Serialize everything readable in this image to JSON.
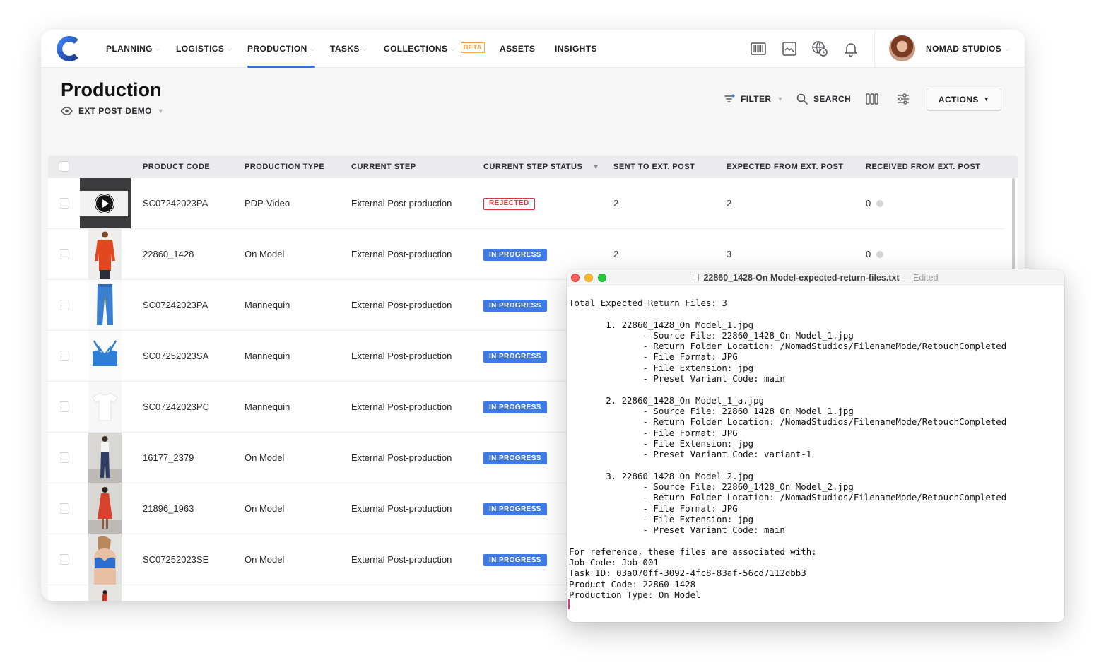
{
  "nav": {
    "items": [
      {
        "label": "PLANNING",
        "dropdown": true
      },
      {
        "label": "LOGISTICS",
        "dropdown": true
      },
      {
        "label": "PRODUCTION",
        "dropdown": true,
        "active": true
      },
      {
        "label": "TASKS",
        "dropdown": true
      },
      {
        "label": "COLLECTIONS",
        "dropdown": true
      },
      {
        "label": "ASSETS",
        "dropdown": false
      },
      {
        "label": "INSIGHTS",
        "dropdown": false
      }
    ],
    "beta_badge": "BETA",
    "org_name": "NOMAD STUDIOS",
    "icons": [
      "barcode-icon",
      "image-icon",
      "globe-clock-icon",
      "bell-icon"
    ]
  },
  "page": {
    "title": "Production",
    "view_name": "EXT POST DEMO"
  },
  "toolbar": {
    "filter_label": "FILTER",
    "search_label": "SEARCH",
    "actions_label": "ACTIONS"
  },
  "table": {
    "columns": [
      "PRODUCT CODE",
      "PRODUCTION TYPE",
      "CURRENT STEP",
      "CURRENT STEP STATUS",
      "SENT TO EXT. POST",
      "EXPECTED FROM EXT. POST",
      "RECEIVED FROM EXT. POST"
    ],
    "rows": [
      {
        "code": "SC07242023PA",
        "type": "PDP-Video",
        "step": "External Post-production",
        "status": "REJECTED",
        "sent": "2",
        "expected": "2",
        "received": "0",
        "thumb": "video"
      },
      {
        "code": "22860_1428",
        "type": "On Model",
        "step": "External Post-production",
        "status": "IN PROGRESS",
        "sent": "2",
        "expected": "3",
        "received": "0",
        "thumb": "red-jacket"
      },
      {
        "code": "SC07242023PA",
        "type": "Mannequin",
        "step": "External Post-production",
        "status": "IN PROGRESS",
        "thumb": "blue-pants"
      },
      {
        "code": "SC07252023SA",
        "type": "Mannequin",
        "step": "External Post-production",
        "status": "IN PROGRESS",
        "thumb": "blue-bra"
      },
      {
        "code": "SC07242023PC",
        "type": "Mannequin",
        "step": "External Post-production",
        "status": "IN PROGRESS",
        "thumb": "white-tee"
      },
      {
        "code": "16177_2379",
        "type": "On Model",
        "step": "External Post-production",
        "status": "IN PROGRESS",
        "thumb": "model-white-top"
      },
      {
        "code": "21896_1963",
        "type": "On Model",
        "step": "External Post-production",
        "status": "IN PROGRESS",
        "thumb": "model-red-dress"
      },
      {
        "code": "SC07252023SE",
        "type": "On Model",
        "step": "External Post-production",
        "status": "IN PROGRESS",
        "thumb": "model-blue-bra"
      }
    ]
  },
  "editor": {
    "filename": "22860_1428-On Model-expected-return-files.txt",
    "separator": "—",
    "state": "Edited",
    "content": "Total Expected Return Files: 3\n\n       1. 22860_1428_On Model_1.jpg\n              - Source File: 22860_1428_On Model_1.jpg\n              - Return Folder Location: /NomadStudios/FilenameMode/RetouchCompleted\n              - File Format: JPG\n              - File Extension: jpg\n              - Preset Variant Code: main\n\n       2. 22860_1428_On Model_1_a.jpg\n              - Source File: 22860_1428_On Model_1.jpg\n              - Return Folder Location: /NomadStudios/FilenameMode/RetouchCompleted\n              - File Format: JPG\n              - File Extension: jpg\n              - Preset Variant Code: variant-1\n\n       3. 22860_1428_On Model_2.jpg\n              - Source File: 22860_1428_On Model_2.jpg\n              - Return Folder Location: /NomadStudios/FilenameMode/RetouchCompleted\n              - File Format: JPG\n              - File Extension: jpg\n              - Preset Variant Code: main\n\nFor reference, these files are associated with:\nJob Code: Job-001\nTask ID: 03a070ff-3092-4fc8-83af-56cd7112dbb3\nProduct Code: 22860_1428\nProduction Type: On Model"
  },
  "colors": {
    "accent": "#2f6fe0",
    "in_progress": "#3f7be6",
    "rejected": "#e0333b",
    "beta": "#f0a64c"
  }
}
